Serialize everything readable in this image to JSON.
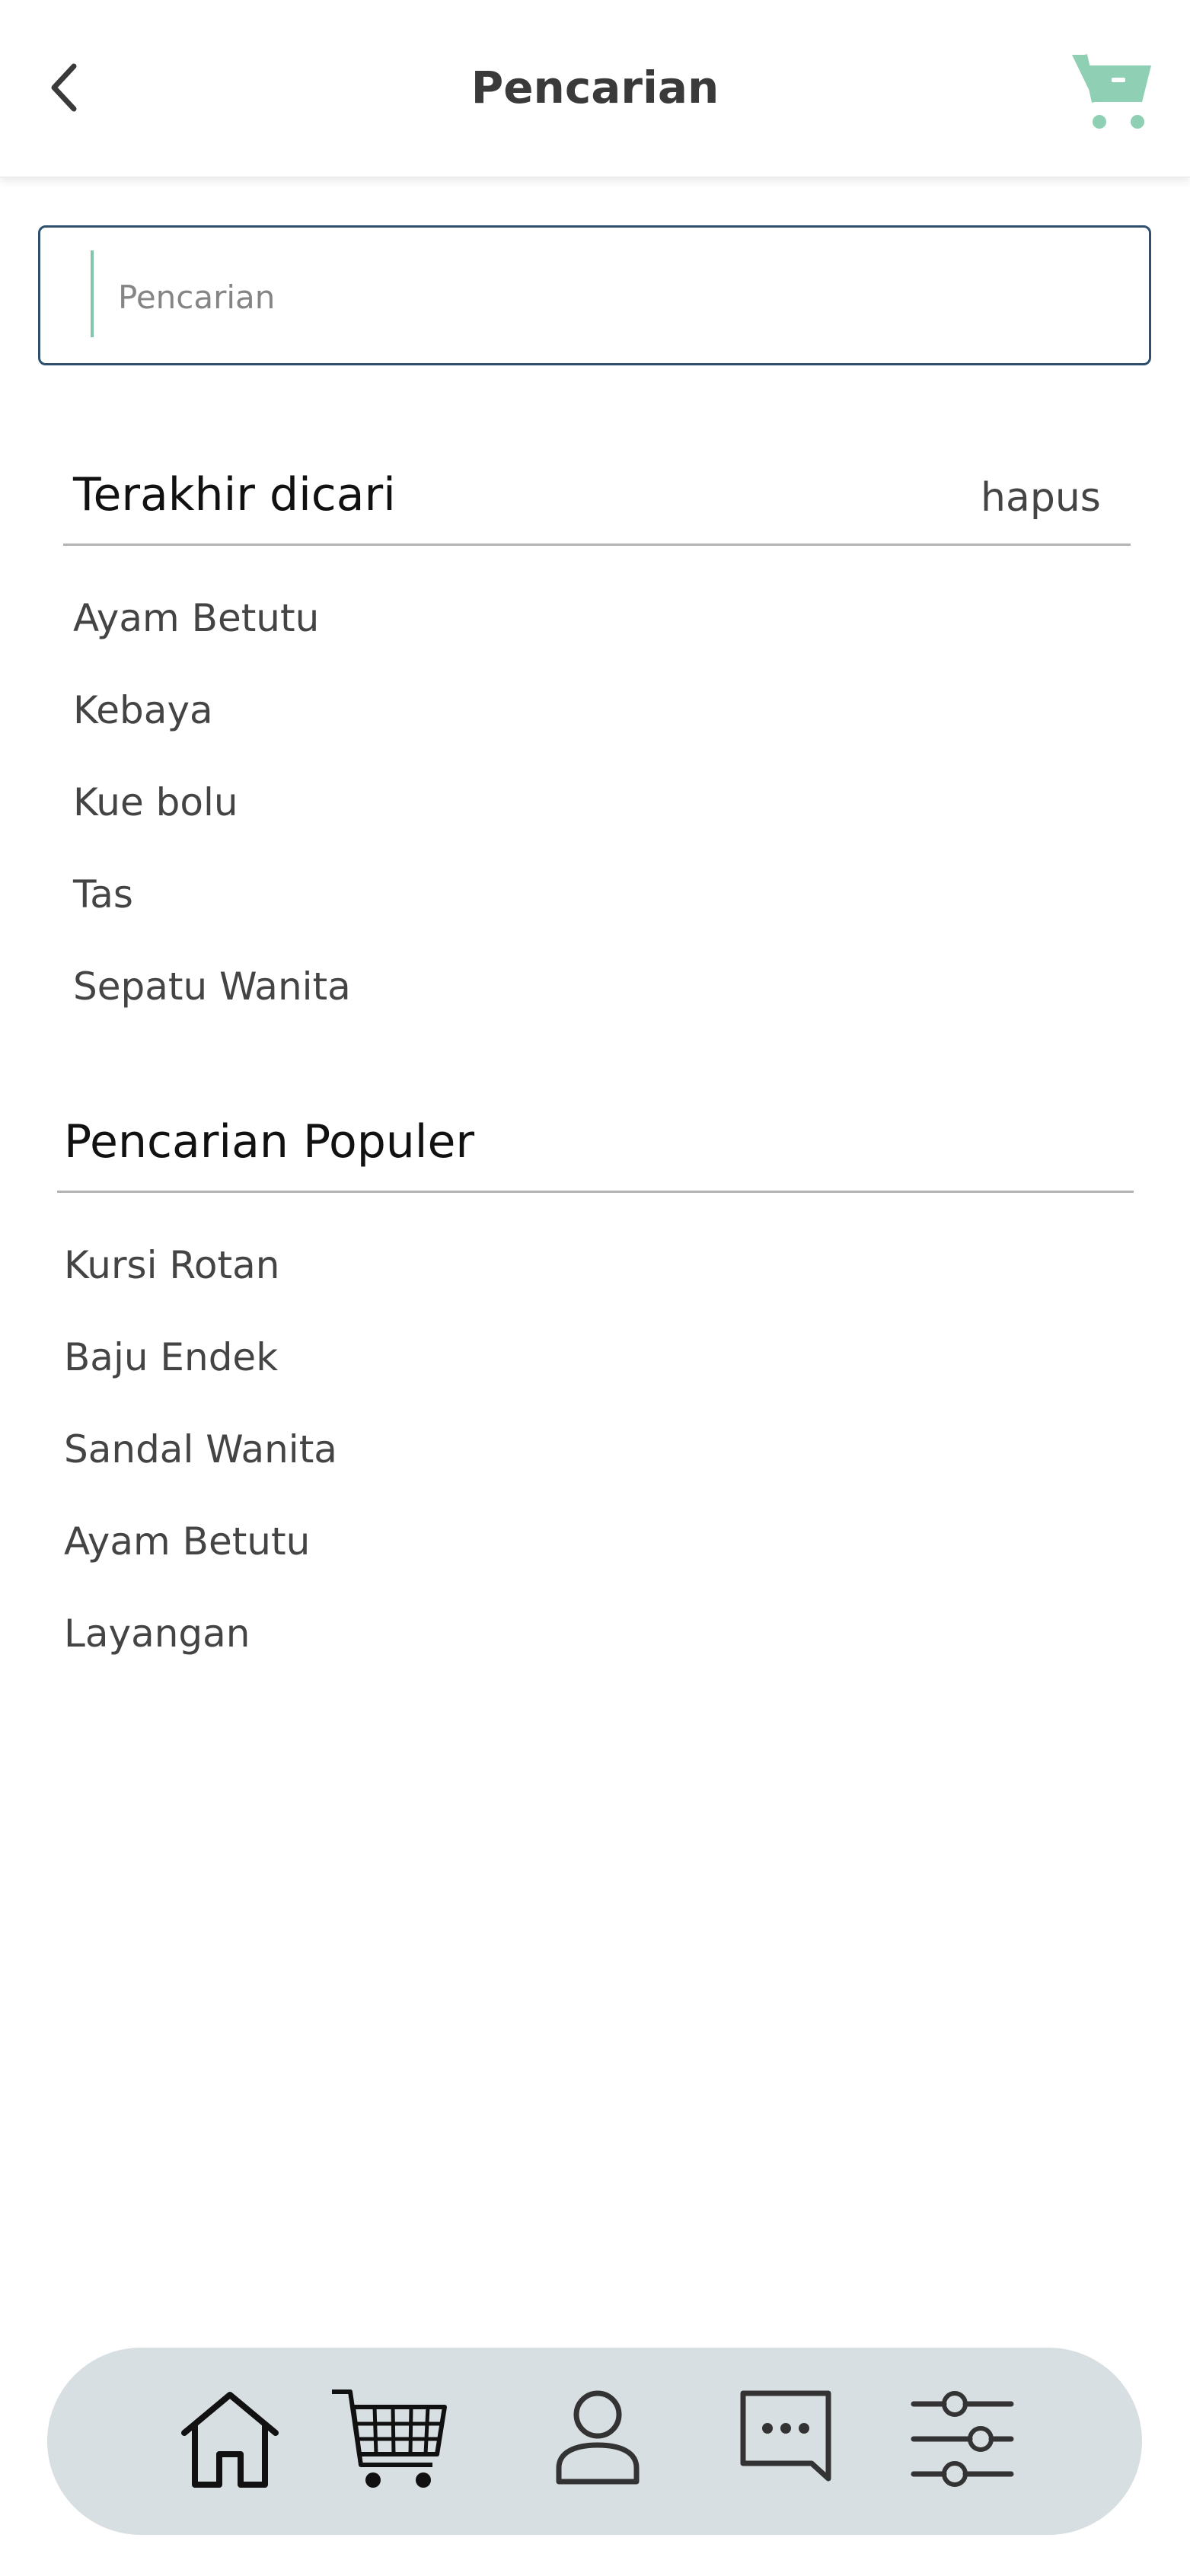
{
  "header": {
    "title": "Pencarian",
    "back_icon": "chevron-left-icon",
    "cart_icon": "cart-icon",
    "cart_color": "#8fcfb3"
  },
  "search": {
    "placeholder": "Pencarian",
    "value": "",
    "caret_color": "#7fc7a8",
    "border_color": "#2f4f6e"
  },
  "recent": {
    "title": "Terakhir dicari",
    "clear_label": "hapus",
    "items": [
      {
        "label": "Ayam Betutu"
      },
      {
        "label": "Kebaya"
      },
      {
        "label": "Kue bolu"
      },
      {
        "label": "Tas"
      },
      {
        "label": "Sepatu Wanita"
      }
    ]
  },
  "popular": {
    "title": "Pencarian Populer",
    "items": [
      {
        "label": "Kursi Rotan"
      },
      {
        "label": "Baju Endek"
      },
      {
        "label": "Sandal Wanita"
      },
      {
        "label": "Ayam Betutu"
      },
      {
        "label": "Layangan"
      }
    ]
  },
  "bottom_nav": {
    "background": "#d8dfe3",
    "items": [
      {
        "icon": "home-icon"
      },
      {
        "icon": "shopping-cart-icon"
      },
      {
        "icon": "user-icon"
      },
      {
        "icon": "chat-icon"
      },
      {
        "icon": "sliders-icon"
      }
    ]
  }
}
